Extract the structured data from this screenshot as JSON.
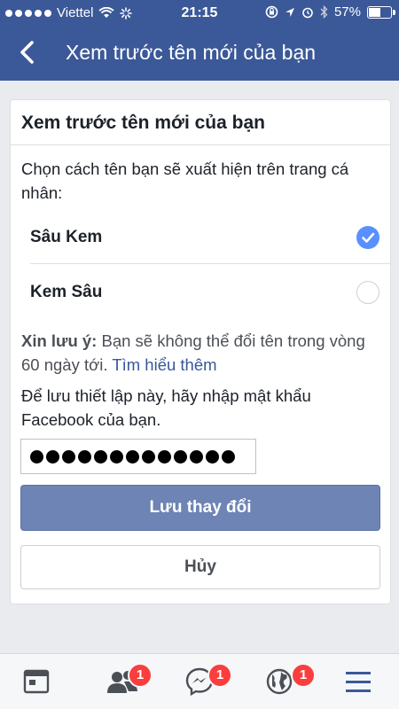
{
  "status_bar": {
    "carrier": "Viettel",
    "time": "21:15",
    "battery": "57%",
    "battery_level": 0.57
  },
  "header": {
    "title": "Xem trước tên mới của bạn",
    "back_icon": "chevron-left-icon",
    "background": "#3b5998"
  },
  "card": {
    "title": "Xem trước tên mới của bạn",
    "prompt": "Chọn cách tên bạn sẽ xuất hiện trên trang cá nhân:",
    "options": [
      {
        "label": "Sâu Kem",
        "selected": true
      },
      {
        "label": "Kem Sâu",
        "selected": false
      }
    ],
    "notice_bold": "Xin lưu ý:",
    "notice_text": "Bạn sẽ không thể đổi tên trong vòng 60 ngày tới.",
    "notice_link": "Tìm hiểu thêm",
    "password_prompt": "Để lưu thiết lập này, hãy nhập mật khẩu Facebook của bạn.",
    "password_length": 13,
    "save_label": "Lưu thay đổi",
    "cancel_label": "Hủy"
  },
  "tabbar": {
    "tabs": [
      {
        "icon": "news-feed-icon",
        "badge": ""
      },
      {
        "icon": "friend-requests-icon",
        "badge": "1"
      },
      {
        "icon": "messenger-icon",
        "badge": "1"
      },
      {
        "icon": "notifications-globe-icon",
        "badge": "1"
      },
      {
        "icon": "menu-icon",
        "badge": ""
      }
    ]
  },
  "colors": {
    "accent": "#3b5998",
    "save_button": "#6d84b4",
    "check": "#5890ff",
    "badge": "#fa3e3e"
  }
}
